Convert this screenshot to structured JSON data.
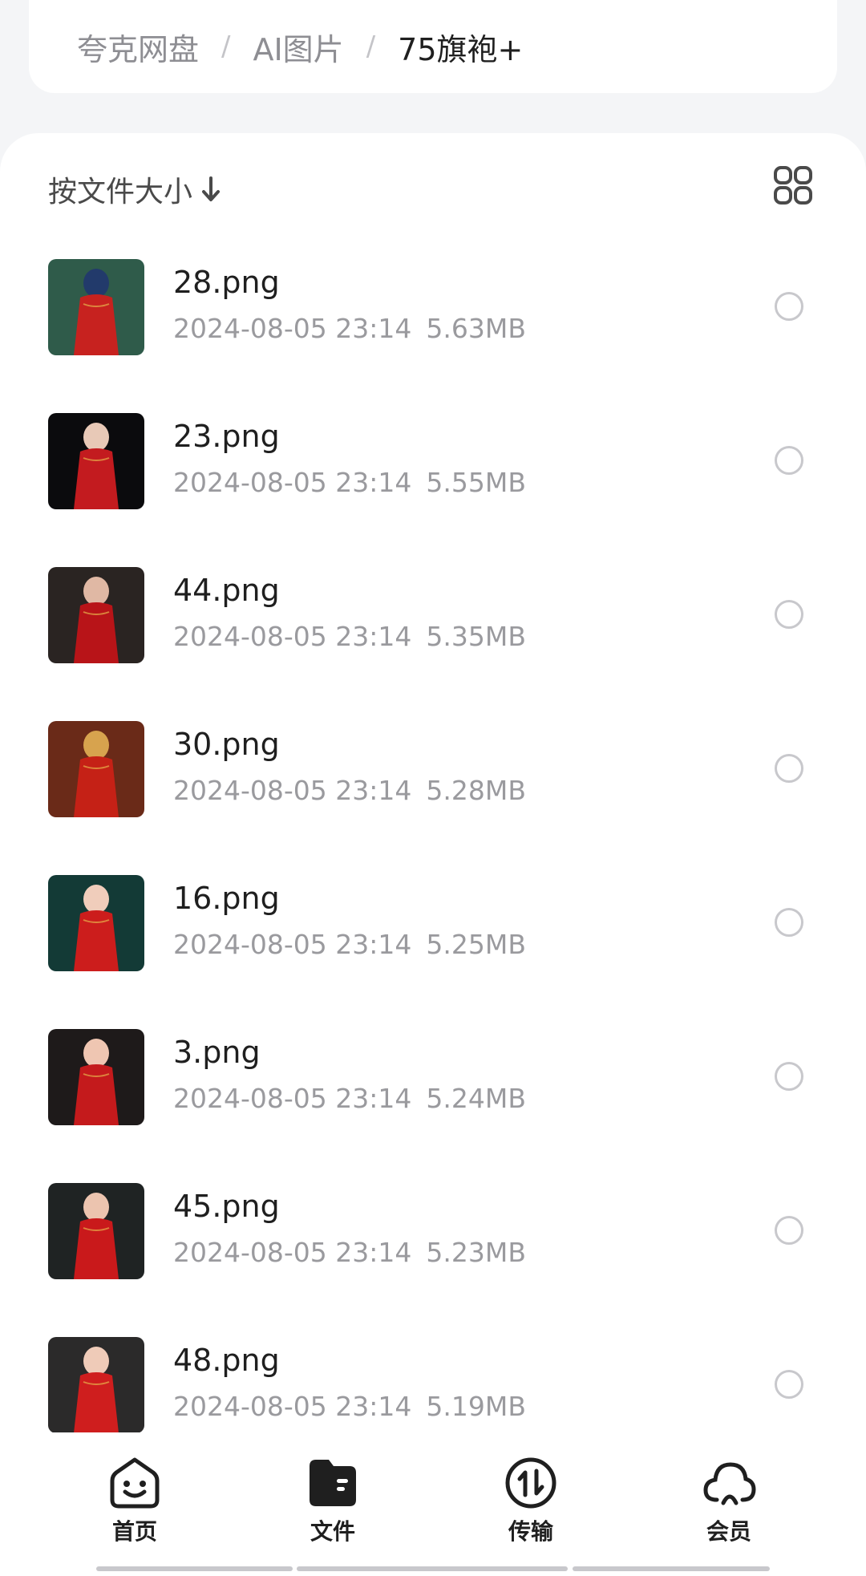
{
  "breadcrumb": {
    "items": [
      "夸克网盘",
      "AI图片",
      "75旗袍+"
    ],
    "separator": "/"
  },
  "toolbar": {
    "sort_label": "按文件大小",
    "sort_direction": "descending",
    "view_toggle_icon": "grid-icon"
  },
  "files": [
    {
      "name": "28.png",
      "date": "2024-08-05 23:14",
      "size": "5.63MB",
      "thumb_colors": [
        "#2f5b4a",
        "#c7221f",
        "#223a6b"
      ]
    },
    {
      "name": "23.png",
      "date": "2024-08-05 23:14",
      "size": "5.55MB",
      "thumb_colors": [
        "#0b0b0d",
        "#c31b1f",
        "#e8c9b7"
      ]
    },
    {
      "name": "44.png",
      "date": "2024-08-05 23:14",
      "size": "5.35MB",
      "thumb_colors": [
        "#2a2422",
        "#b81418",
        "#e0b8a4"
      ]
    },
    {
      "name": "30.png",
      "date": "2024-08-05 23:14",
      "size": "5.28MB",
      "thumb_colors": [
        "#6a2a18",
        "#c52116",
        "#d7a34e"
      ]
    },
    {
      "name": "16.png",
      "date": "2024-08-05 23:14",
      "size": "5.25MB",
      "thumb_colors": [
        "#133a36",
        "#cc1d1c",
        "#f0cdbb"
      ]
    },
    {
      "name": "3.png",
      "date": "2024-08-05 23:14",
      "size": "5.24MB",
      "thumb_colors": [
        "#1e1a1a",
        "#c41a1c",
        "#efc6b2"
      ]
    },
    {
      "name": "45.png",
      "date": "2024-08-05 23:14",
      "size": "5.23MB",
      "thumb_colors": [
        "#1f2323",
        "#c9191b",
        "#ecc4af"
      ]
    },
    {
      "name": "48.png",
      "date": "2024-08-05 23:14",
      "size": "5.19MB",
      "thumb_colors": [
        "#2b2a2a",
        "#cf1e1e",
        "#efcbb8"
      ]
    }
  ],
  "nav": [
    {
      "label": "首页",
      "icon": "smiley-home-icon"
    },
    {
      "label": "文件",
      "icon": "folder-icon"
    },
    {
      "label": "传输",
      "icon": "transfer-icon"
    },
    {
      "label": "会员",
      "icon": "cloud-icon"
    }
  ]
}
